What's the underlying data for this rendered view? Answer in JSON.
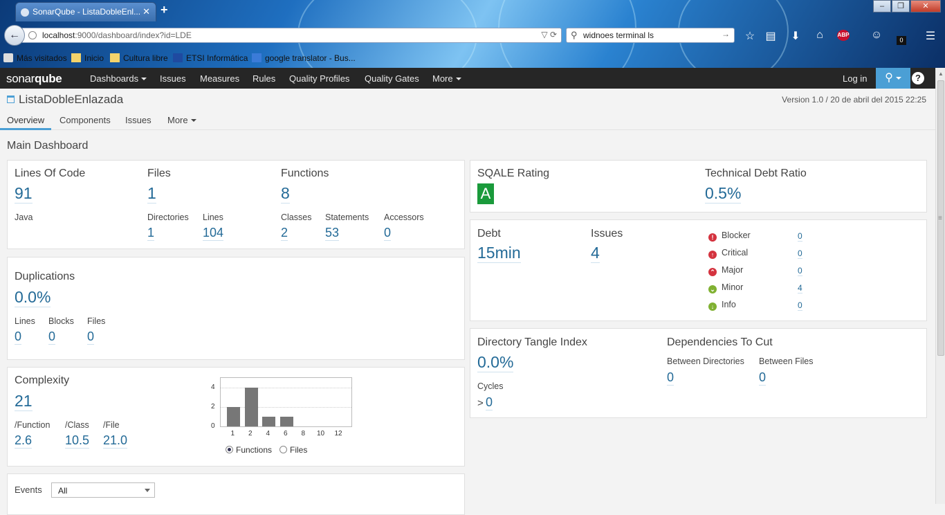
{
  "browser": {
    "tab_title": "SonarQube - ListaDobleEnl...",
    "tab_close": "✕",
    "new_tab": "+",
    "url_host": "localhost",
    "url_rest": ":9000/dashboard/index?id=LDE",
    "search_text": "widnoes terminal ls",
    "download_count": "0",
    "adblock_label": "ABP",
    "window_buttons": [
      "–",
      "❐",
      "✕"
    ],
    "bookmarks": [
      "Más visitados",
      "Inicio",
      "Cultura libre",
      "ETSI Informática",
      "google translator - Bus..."
    ]
  },
  "sonar_nav": {
    "logo_bold": "sonar",
    "logo_rest": "qube",
    "items": [
      "Dashboards",
      "Issues",
      "Measures",
      "Rules",
      "Quality Profiles",
      "Quality Gates",
      "More"
    ],
    "login": "Log in",
    "help": "?"
  },
  "project": {
    "name": "ListaDobleEnlazada",
    "version": "Version 1.0 / 20 de abril del 2015 22:25",
    "tabs": [
      "Overview",
      "Components",
      "Issues",
      "More"
    ]
  },
  "dashboard_title": "Main Dashboard",
  "size": {
    "loc_label": "Lines Of Code",
    "loc": "91",
    "language": "Java",
    "files_label": "Files",
    "files": "1",
    "directories_label": "Directories",
    "directories": "1",
    "lines_label": "Lines",
    "lines": "104",
    "functions_label": "Functions",
    "functions": "8",
    "classes_label": "Classes",
    "classes": "2",
    "statements_label": "Statements",
    "statements": "53",
    "accessors_label": "Accessors",
    "accessors": "0"
  },
  "duplications": {
    "title": "Duplications",
    "value": "0.0%",
    "lines_label": "Lines",
    "lines": "0",
    "blocks_label": "Blocks",
    "blocks": "0",
    "files_label": "Files",
    "files": "0"
  },
  "complexity": {
    "title": "Complexity",
    "value": "21",
    "per_function_label": "/Function",
    "per_function": "2.6",
    "per_class_label": "/Class",
    "per_class": "10.5",
    "per_file_label": "/File",
    "per_file": "21.0",
    "radio_functions": "Functions",
    "radio_files": "Files"
  },
  "chart_data": {
    "type": "bar",
    "categories": [
      "1",
      "2",
      "4",
      "6",
      "8",
      "10",
      "12"
    ],
    "values": [
      2,
      4,
      1,
      1,
      0,
      0,
      0
    ],
    "yticks": [
      "0",
      "2",
      "4"
    ],
    "ylim": [
      0,
      5
    ],
    "title": "",
    "xlabel": "",
    "ylabel": ""
  },
  "events": {
    "label": "Events",
    "selected": "All"
  },
  "sqale": {
    "rating_label": "SQALE Rating",
    "rating": "A",
    "rating_color": "#1a9a3b",
    "debt_ratio_label": "Technical Debt Ratio",
    "debt_ratio": "0.5%"
  },
  "debt": {
    "debt_label": "Debt",
    "debt": "15min",
    "issues_label": "Issues",
    "issues": "4",
    "severities": [
      {
        "name": "Blocker",
        "count": "0",
        "color": "#d4333f",
        "icon": "!"
      },
      {
        "name": "Critical",
        "count": "0",
        "color": "#d4333f",
        "icon": "↑"
      },
      {
        "name": "Major",
        "count": "0",
        "color": "#d4333f",
        "icon": "⌃"
      },
      {
        "name": "Minor",
        "count": "4",
        "color": "#80b132",
        "icon": "⌄"
      },
      {
        "name": "Info",
        "count": "0",
        "color": "#80b132",
        "icon": "↓"
      }
    ]
  },
  "tangle": {
    "title": "Directory Tangle Index",
    "value": "0.0%",
    "cycles_label": "Cycles",
    "cycles_prefix": ">",
    "cycles": "0",
    "deps_title": "Dependencies To Cut",
    "between_dirs_label": "Between Directories",
    "between_dirs": "0",
    "between_files_label": "Between Files",
    "between_files": "0"
  }
}
